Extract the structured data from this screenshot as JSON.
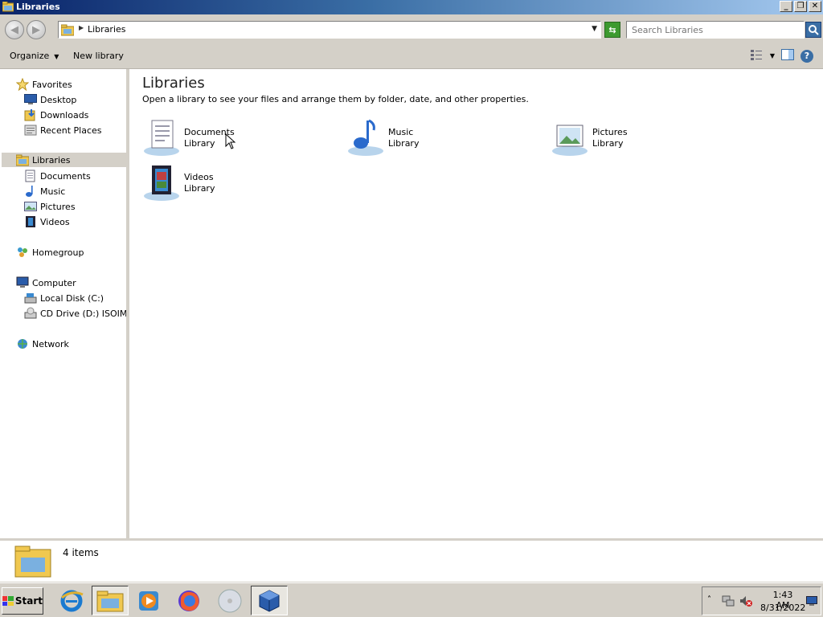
{
  "window": {
    "title": "Libraries",
    "controls": [
      "minimize",
      "maximize",
      "close"
    ]
  },
  "address_bar": {
    "path": "Libraries",
    "search_placeholder": "Search Libraries"
  },
  "toolbar": {
    "organize_label": "Organize",
    "new_library_label": "New library"
  },
  "sidebar": {
    "favorites": {
      "label": "Favorites",
      "items": [
        {
          "label": "Desktop",
          "icon": "desktop-icon"
        },
        {
          "label": "Downloads",
          "icon": "downloads-icon"
        },
        {
          "label": "Recent Places",
          "icon": "recent-places-icon"
        }
      ]
    },
    "libraries": {
      "label": "Libraries",
      "items": [
        {
          "label": "Documents",
          "icon": "documents-icon"
        },
        {
          "label": "Music",
          "icon": "music-icon"
        },
        {
          "label": "Pictures",
          "icon": "pictures-icon"
        },
        {
          "label": "Videos",
          "icon": "videos-icon"
        }
      ]
    },
    "homegroup": {
      "label": "Homegroup"
    },
    "computer": {
      "label": "Computer",
      "items": [
        {
          "label": "Local Disk (C:)",
          "icon": "hard-disk-icon"
        },
        {
          "label": "CD Drive (D:) ISOIMAGE",
          "icon": "cd-drive-icon"
        }
      ]
    },
    "network": {
      "label": "Network"
    }
  },
  "main": {
    "title": "Libraries",
    "subtitle": "Open a library to see your files and arrange them by folder, date, and other properties.",
    "libraries": [
      {
        "name": "Documents",
        "type": "Library",
        "icon": "documents-library-icon"
      },
      {
        "name": "Music",
        "type": "Library",
        "icon": "music-library-icon"
      },
      {
        "name": "Pictures",
        "type": "Library",
        "icon": "pictures-library-icon"
      },
      {
        "name": "Videos",
        "type": "Library",
        "icon": "videos-library-icon"
      }
    ]
  },
  "details_pane": {
    "item_count": "4 items"
  },
  "taskbar": {
    "start_label": "Start",
    "apps": [
      "internet-explorer-icon",
      "windows-explorer-icon",
      "media-player-icon",
      "firefox-icon",
      "disc-icon",
      "virtualbox-icon"
    ],
    "clock_time": "1:43 AM",
    "clock_date": "8/31/2022"
  },
  "colors": {
    "title_gradient_start": "#0a246a",
    "title_gradient_end": "#a6caf0",
    "selection": "#d4d0c8",
    "accent": "#3a6ea5"
  }
}
